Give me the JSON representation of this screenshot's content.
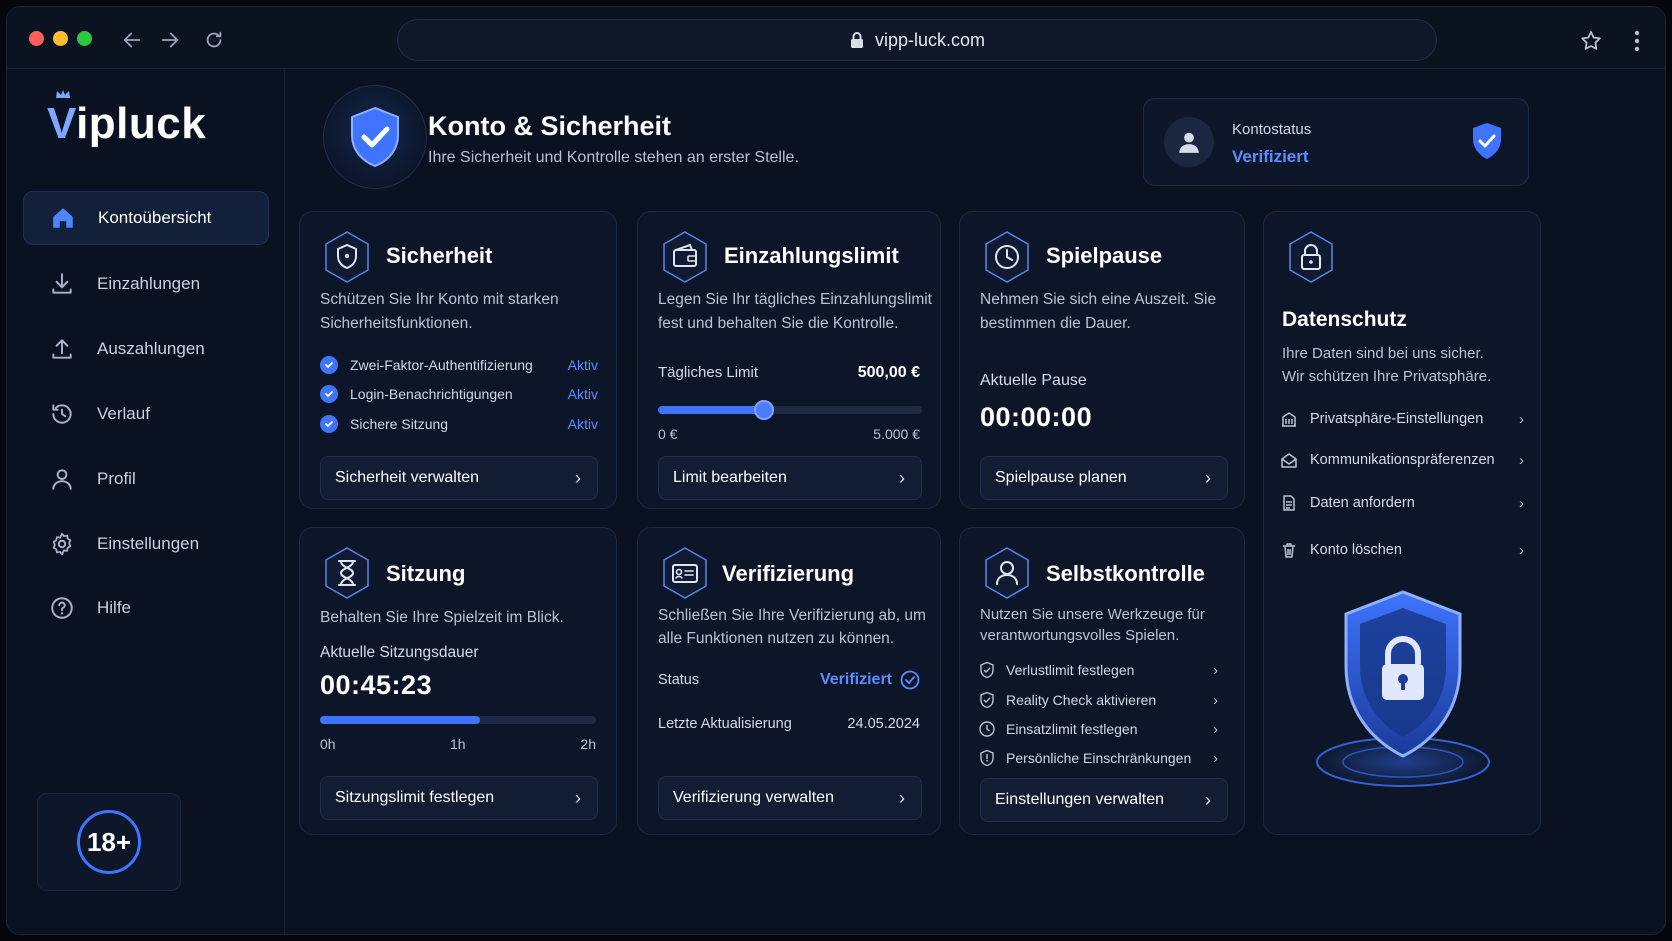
{
  "browser": {
    "url": "vipp-luck.com"
  },
  "brand": {
    "logo_v": "V",
    "logo_rest": "ipluck"
  },
  "sidebar": {
    "items": [
      {
        "label": "Kontoübersicht",
        "icon": "home-icon",
        "active": true
      },
      {
        "label": "Einzahlungen",
        "icon": "download-icon"
      },
      {
        "label": "Auszahlungen",
        "icon": "upload-icon"
      },
      {
        "label": "Verlauf",
        "icon": "history-icon"
      },
      {
        "label": "Profil",
        "icon": "user-icon"
      },
      {
        "label": "Einstellungen",
        "icon": "gear-icon"
      },
      {
        "label": "Hilfe",
        "icon": "help-icon"
      }
    ],
    "age_badge": "18+"
  },
  "header": {
    "title": "Konto & Sicherheit",
    "subtitle": "Ihre Sicherheit und Kontrolle stehen an erster Stelle."
  },
  "account_status": {
    "label": "Kontostatus",
    "value": "Verifiziert"
  },
  "security": {
    "title": "Sicherheit",
    "desc1": "Schützen Sie Ihr Konto mit starken",
    "desc2": "Sicherheitsfunktionen.",
    "features": [
      {
        "label": "Zwei-Faktor-Authentifizierung",
        "status": "Aktiv"
      },
      {
        "label": "Login-Benachrichtigungen",
        "status": "Aktiv"
      },
      {
        "label": "Sichere Sitzung",
        "status": "Aktiv"
      }
    ],
    "button": "Sicherheit verwalten"
  },
  "deposit_limit": {
    "title": "Einzahlungslimit",
    "desc1": "Legen Sie Ihr tägliches Einzahlungslimit",
    "desc2": "fest und behalten Sie die Kontrolle.",
    "limit_label": "Tägliches Limit",
    "limit_value": "500,00 €",
    "min_label": "0 €",
    "max_label": "5.000 €",
    "slider_fraction": 0.4,
    "button": "Limit bearbeiten"
  },
  "break": {
    "title": "Spielpause",
    "desc1": "Nehmen Sie sich eine Auszeit. Sie",
    "desc2": "bestimmen die Dauer.",
    "current_label": "Aktuelle Pause",
    "current_value": "00:00:00",
    "button": "Spielpause planen"
  },
  "privacy": {
    "title": "Datenschutz",
    "desc1": "Ihre Daten sind bei uns sicher.",
    "desc2": "Wir schützen Ihre Privatsphäre.",
    "links": [
      {
        "label": "Privatsphäre-Einstellungen",
        "icon": "building-icon"
      },
      {
        "label": "Kommunikationspräferenzen",
        "icon": "mail-icon"
      },
      {
        "label": "Daten anfordern",
        "icon": "document-icon"
      },
      {
        "label": "Konto löschen",
        "icon": "trash-icon"
      }
    ]
  },
  "session": {
    "title": "Sitzung",
    "desc": "Behalten Sie Ihre Spielzeit im Blick.",
    "duration_label": "Aktuelle Sitzungsdauer",
    "duration_value": "00:45:23",
    "progress_fraction": 0.58,
    "ticks": [
      "0h",
      "1h",
      "2h"
    ],
    "button": "Sitzungslimit festlegen"
  },
  "verification": {
    "title": "Verifizierung",
    "desc1": "Schließen Sie Ihre Verifizierung ab, um",
    "desc2": "alle Funktionen nutzen zu können.",
    "status_label": "Status",
    "status_value": "Verifiziert",
    "updated_label": "Letzte Aktualisierung",
    "updated_value": "24.05.2024",
    "button": "Verifizierung verwalten"
  },
  "self_control": {
    "title": "Selbstkontrolle",
    "desc1": "Nutzen Sie unsere Werkzeuge für",
    "desc2": "verantwortungsvolles Spielen.",
    "links": [
      {
        "label": "Verlustlimit festlegen"
      },
      {
        "label": "Reality Check aktivieren"
      },
      {
        "label": "Einsatzlimit festlegen"
      },
      {
        "label": "Persönliche Einschränkungen"
      }
    ],
    "button": "Einstellungen verwalten"
  },
  "colors": {
    "accent": "#3f74ff",
    "accent_text": "#5b8cff",
    "background": "#0a1120",
    "card": "#0d1628"
  }
}
